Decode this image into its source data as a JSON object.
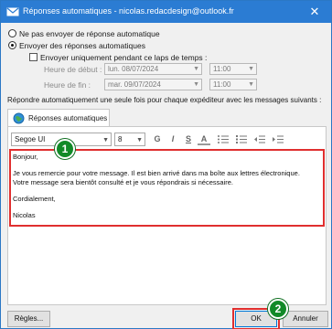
{
  "window": {
    "title": "Réponses automatiques - nicolas.redacdesign@outlook.fr",
    "close_glyph": "✕"
  },
  "options": {
    "no_reply_label": "Ne pas envoyer de réponse automatique",
    "send_reply_label": "Envoyer des réponses automatiques",
    "time_range_label": "Envoyer uniquement pendant ce laps de temps :",
    "start_label": "Heure de début :",
    "end_label": "Heure de fin :",
    "start_date": "lun. 08/07/2024",
    "start_time": "11:00",
    "end_date": "mar. 09/07/2024",
    "end_time": "11:00"
  },
  "instruction": "Répondre automatiquement une seule fois pour chaque expéditeur avec les messages suivants :",
  "tab": {
    "label": "Réponses automatiques"
  },
  "toolbar": {
    "font": "Segoe UI",
    "size": "8",
    "bold": "G",
    "italic": "I",
    "underline": "S",
    "font_color": "A"
  },
  "message": {
    "lines": [
      "Bonjour,",
      "",
      "Je vous remercie pour votre message. Il est bien arrivé dans ma boîte aux lettres électronique.",
      "Votre message sera bientôt consulté et je vous répondrais si nécessaire.",
      "",
      "Cordialement,",
      "",
      "Nicolas"
    ]
  },
  "buttons": {
    "rules": "Règles...",
    "ok": "OK",
    "cancel": "Annuler"
  },
  "annotations": {
    "badge1": "1",
    "badge2": "2",
    "highlight_color": "#e02f2f",
    "badge_color": "#128a28"
  }
}
